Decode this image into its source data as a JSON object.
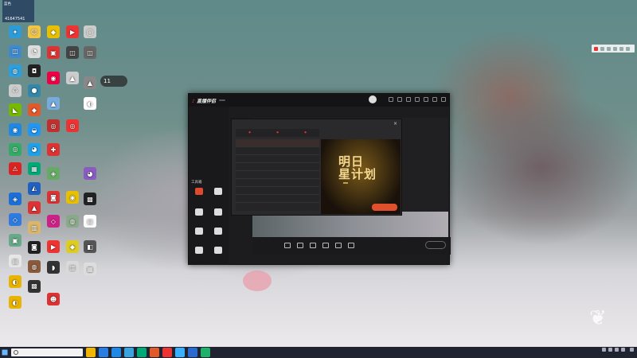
{
  "desktop": {
    "user_tag": {
      "label": "蓝色",
      "number": "41647541"
    },
    "clock_widget": "11",
    "icons_col1": [
      {
        "label": "",
        "color": "#2e9bd9",
        "glyph": "✦"
      },
      {
        "label": "",
        "color": "#3c8bd0",
        "glyph": "◫"
      },
      {
        "label": "",
        "color": "#2aa0e0",
        "glyph": "◍"
      },
      {
        "label": "",
        "color": "#cccccc",
        "glyph": "♺"
      },
      {
        "label": "",
        "color": "#76b900",
        "glyph": "◣"
      },
      {
        "label": "",
        "color": "#1e88e5",
        "glyph": "◉"
      },
      {
        "label": "",
        "color": "#3a6",
        "glyph": "◎"
      },
      {
        "label": "",
        "color": "#d22",
        "glyph": "⚠"
      },
      {
        "label": "",
        "color": "#1b6fd6",
        "glyph": "◈"
      },
      {
        "label": "",
        "color": "#2d7be0",
        "glyph": "◇"
      },
      {
        "label": "",
        "color": "#6a8",
        "glyph": "▣"
      },
      {
        "label": "",
        "color": "#e6e6e6",
        "glyph": "▤"
      },
      {
        "label": "",
        "color": "#e8b400",
        "glyph": "◐"
      },
      {
        "label": "",
        "color": "#e8b400",
        "glyph": "◐"
      }
    ],
    "icons_col2": [
      {
        "label": "",
        "color": "#f4c542",
        "glyph": "☺"
      },
      {
        "label": "",
        "color": "#ddd",
        "glyph": "◔"
      },
      {
        "label": "",
        "color": "#222",
        "glyph": "◘"
      },
      {
        "label": "",
        "color": "#38a",
        "glyph": "●"
      },
      {
        "label": "",
        "color": "#e05a2c",
        "glyph": "◆"
      },
      {
        "label": "",
        "color": "#2196f3",
        "glyph": "◒"
      },
      {
        "label": "",
        "color": "#1fa0e8",
        "glyph": "◕"
      },
      {
        "label": "",
        "color": "#0a7",
        "glyph": "▦"
      },
      {
        "label": "",
        "color": "#2060c0",
        "glyph": "◭"
      },
      {
        "label": "",
        "color": "#d33",
        "glyph": "▲"
      },
      {
        "label": "",
        "color": "#d9b66a",
        "glyph": "▥"
      },
      {
        "label": "",
        "color": "#222",
        "glyph": "◙"
      },
      {
        "label": "",
        "color": "#8a5a3a",
        "glyph": "◍"
      },
      {
        "label": "",
        "color": "#333",
        "glyph": "▩"
      }
    ],
    "icons_col3": [
      {
        "label": "",
        "color": "#e8c000",
        "glyph": "◆"
      },
      {
        "label": "",
        "color": "#d33",
        "glyph": "▣"
      },
      {
        "label": "",
        "color": "#e04",
        "glyph": "◉"
      },
      {
        "label": "",
        "color": "#7ad",
        "glyph": "▲"
      },
      {
        "label": "",
        "color": "#c03030",
        "glyph": "◎"
      },
      {
        "label": "",
        "color": "#d33",
        "glyph": "✚"
      },
      {
        "label": "",
        "color": "#6a6",
        "glyph": "◈"
      },
      {
        "label": "",
        "color": "#d33",
        "glyph": "◙"
      },
      {
        "label": "",
        "color": "#c28",
        "glyph": "◇"
      },
      {
        "label": "",
        "color": "#e33",
        "glyph": "▶"
      },
      {
        "label": "",
        "color": "#333",
        "glyph": "◗"
      },
      {
        "label": "",
        "color": "#d33",
        "glyph": "☻"
      }
    ],
    "icons_col4": [
      {
        "label": "",
        "color": "#e33",
        "glyph": "▶"
      },
      {
        "label": "",
        "color": "#444",
        "glyph": "◫"
      },
      {
        "label": "",
        "color": "#ccc",
        "glyph": "▲"
      },
      {
        "label": "",
        "color": "#e33",
        "glyph": "◎"
      },
      {
        "label": "",
        "color": "#e8c000",
        "glyph": "◉"
      },
      {
        "label": "",
        "color": "#8a8",
        "glyph": "◍"
      },
      {
        "label": "",
        "color": "#dc2",
        "glyph": "◆"
      },
      {
        "label": "",
        "color": "#d9d9d9",
        "glyph": "▥"
      }
    ],
    "icons_col5": [
      {
        "label": "",
        "color": "#ccc",
        "glyph": "◯"
      },
      {
        "label": "",
        "color": "#666",
        "glyph": "◫"
      },
      {
        "label": "",
        "color": "#888",
        "glyph": "▲"
      },
      {
        "label": "",
        "color": "#fff",
        "glyph": "◐"
      },
      {
        "label": "",
        "color": "#8a5cc0",
        "glyph": "◕"
      },
      {
        "label": "",
        "color": "#222",
        "glyph": "▩"
      },
      {
        "label": "",
        "color": "#fff",
        "glyph": "▤"
      },
      {
        "label": "",
        "color": "#555",
        "glyph": "◧"
      },
      {
        "label": "",
        "color": "#ddd",
        "glyph": "▦"
      }
    ]
  },
  "app": {
    "title": "直播伴侣",
    "version": "",
    "scene_tabs": [
      {
        "label": "",
        "active": true
      },
      {
        "label": "",
        "active": false
      },
      {
        "label": "",
        "active": false
      }
    ],
    "scenes": [
      {
        "label": ""
      },
      {
        "label": ""
      },
      {
        "label": ""
      }
    ],
    "toolbox_title": "工具箱",
    "tools": [
      {
        "label": "",
        "red": true
      },
      {
        "label": "",
        "red": false
      },
      {
        "label": "",
        "red": false
      },
      {
        "label": "",
        "red": false
      },
      {
        "label": "",
        "red": false
      },
      {
        "label": "",
        "red": false
      },
      {
        "label": "",
        "red": false
      },
      {
        "label": "",
        "red": false
      }
    ],
    "footer_note": "",
    "topbar": [
      "",
      "",
      ""
    ],
    "bottom_buttons": [
      {
        "label": ""
      },
      {
        "label": ""
      },
      {
        "label": ""
      },
      {
        "label": ""
      },
      {
        "label": ""
      },
      {
        "label": ""
      }
    ],
    "live_button": ""
  },
  "popup": {
    "title": "",
    "tabs": [
      {
        "label": "",
        "active": true
      },
      {
        "label": "",
        "active": false
      },
      {
        "label": "",
        "active": false
      }
    ],
    "rows": [
      {
        "label": "",
        "date": "",
        "selected": true
      },
      {
        "label": "",
        "date": "",
        "selected": false
      },
      {
        "label": "",
        "date": "",
        "selected": false
      },
      {
        "label": "",
        "date": "",
        "selected": false
      },
      {
        "label": "",
        "date": "",
        "selected": false
      },
      {
        "label": "",
        "date": "",
        "selected": false
      },
      {
        "label": "",
        "date": "",
        "selected": false
      },
      {
        "label": "",
        "date": "",
        "selected": false
      }
    ],
    "banner": {
      "logo": "",
      "title": "明日\n星计划",
      "subtitle": "",
      "button": ""
    }
  },
  "taskbar": {
    "search_placeholder": "",
    "apps": [
      "#f2b500",
      "#2a7de1",
      "#1e88e5",
      "#3aa3e0",
      "#0a7",
      "#e05a2c",
      "#e33",
      "#3ab0ff",
      "#2a6ad0",
      "#1fb06a"
    ],
    "time": "",
    "date": ""
  }
}
